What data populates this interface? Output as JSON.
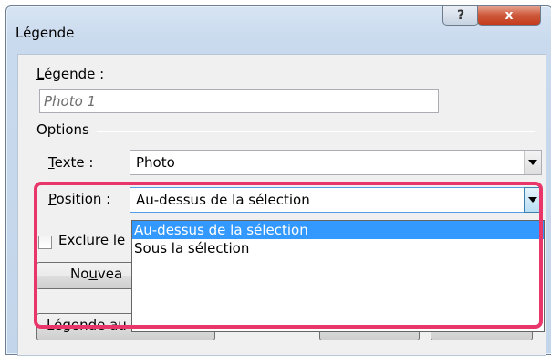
{
  "window": {
    "title": "Légende",
    "help_label": "?",
    "close_label": "x"
  },
  "caption": {
    "label_accel": "L",
    "label_rest": "égende :",
    "value": "Photo 1"
  },
  "options": {
    "group_label": "Options",
    "text_label_accel": "T",
    "text_label_rest": "exte :",
    "text_value": "Photo",
    "position_label_accel": "P",
    "position_label_rest": "osition :",
    "position_value": "Au-dessus de la sélection",
    "exclude_label_accel": "E",
    "exclude_label_rest": "xclure le"
  },
  "dropdown": {
    "options": [
      "Au-dessus de la sélection",
      "Sous la sélection"
    ],
    "selected_index": 0
  },
  "buttons": {
    "new_prefix": "No",
    "new_accel": "u",
    "new_rest": "vea",
    "auto_label": "Légende au"
  },
  "colors": {
    "highlight": "#e8366a",
    "selection": "#3399ff"
  },
  "icons": {
    "help": "question-mark",
    "close": "x-mark",
    "dropdown": "triangle-down"
  }
}
